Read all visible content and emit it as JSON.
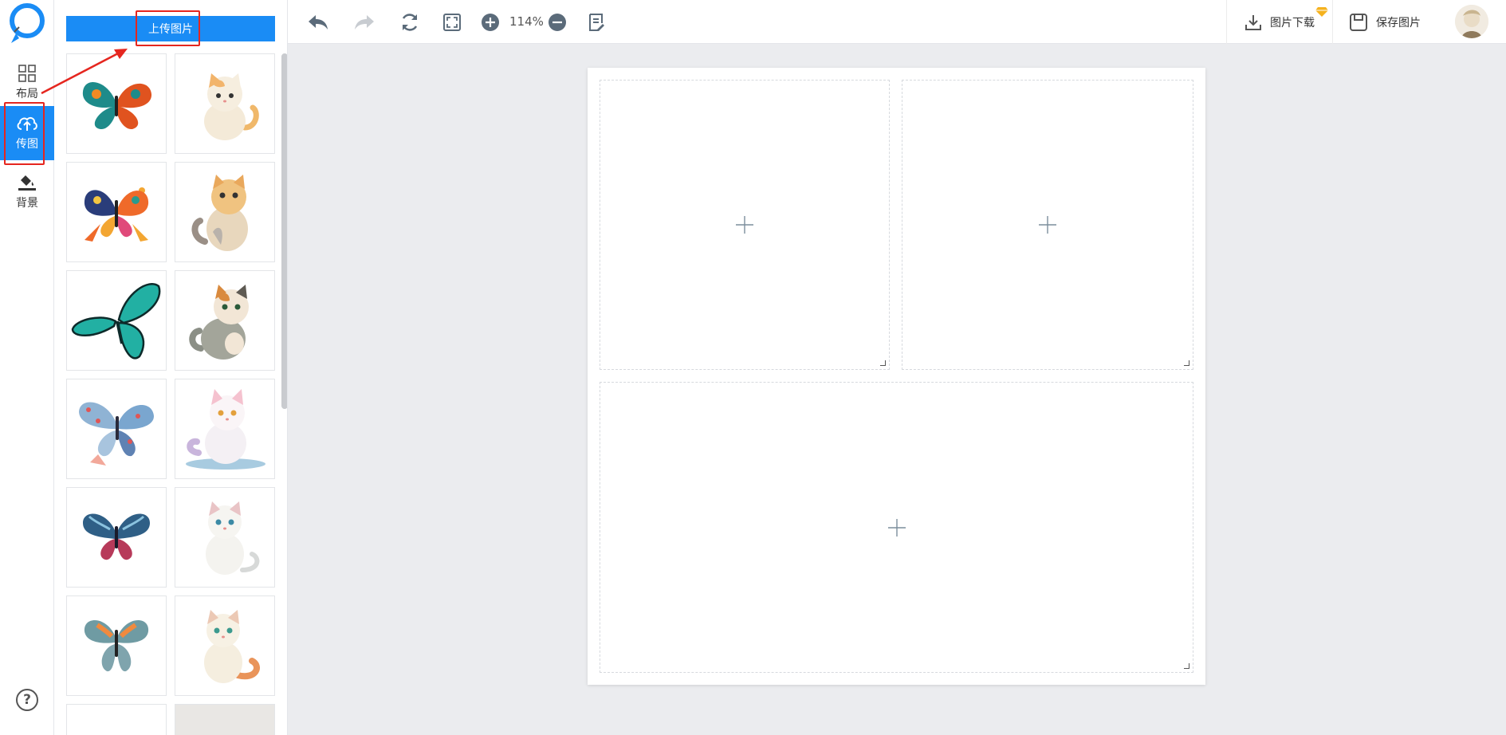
{
  "rail": {
    "items": [
      {
        "label": "布局",
        "icon": "grid-icon"
      },
      {
        "label": "传图",
        "icon": "cloud-upload-icon"
      },
      {
        "label": "背景",
        "icon": "paint-bucket-icon"
      }
    ],
    "help_symbol": "?"
  },
  "panel": {
    "upload_label": "上传图片",
    "thumbnails": [
      {
        "name": "butterfly-multicolor"
      },
      {
        "name": "cat-orange-white"
      },
      {
        "name": "butterfly-floral"
      },
      {
        "name": "cat-calico-looking-up"
      },
      {
        "name": "butterfly-teal"
      },
      {
        "name": "cat-calico-sitting"
      },
      {
        "name": "butterfly-pastel-blue"
      },
      {
        "name": "cat-white-pink"
      },
      {
        "name": "butterfly-dark-blue"
      },
      {
        "name": "cat-white-blue-eyes"
      },
      {
        "name": "butterfly-orange-grey"
      },
      {
        "name": "cat-cream-orange-tail"
      }
    ]
  },
  "toolbar": {
    "zoom": "114%",
    "download_label": "图片下载",
    "save_label": "保存图片"
  },
  "canvas": {
    "cells": [
      {
        "name": "cell-top-left",
        "symbol": "+"
      },
      {
        "name": "cell-top-right",
        "symbol": "+"
      },
      {
        "name": "cell-bottom",
        "symbol": "+"
      }
    ]
  },
  "colors": {
    "accent": "#1a8cf5",
    "annotation": "#e5261f",
    "workspace": "#ebecef"
  }
}
